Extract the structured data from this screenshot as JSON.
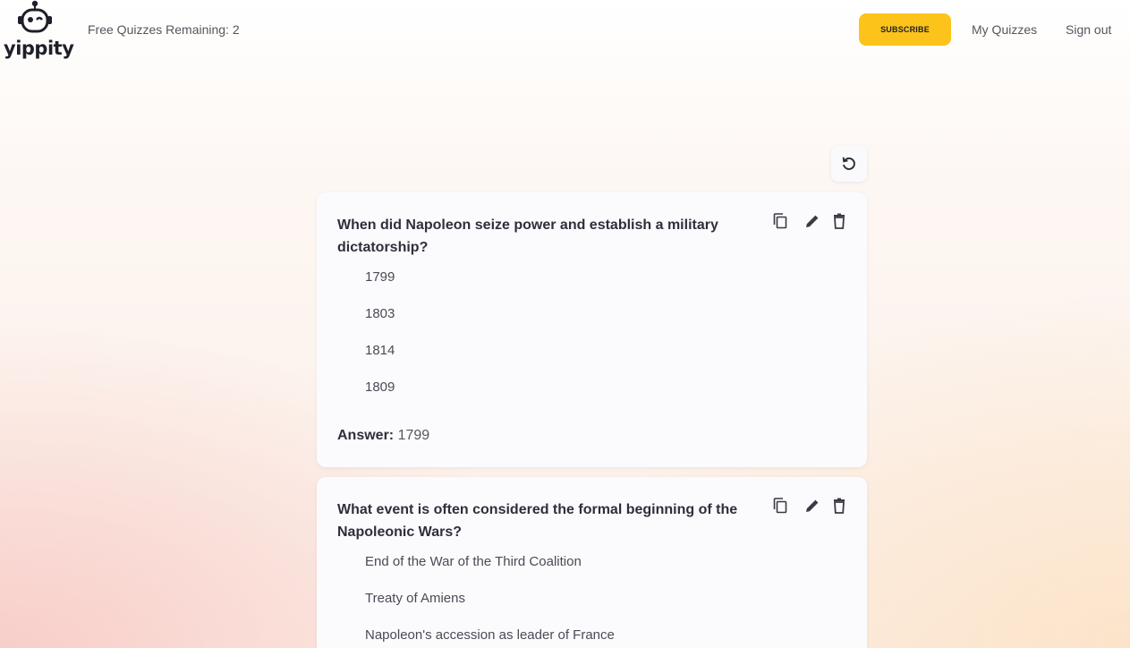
{
  "header": {
    "logo_text": "yippity",
    "free_quizzes": "Free Quizzes Remaining: 2",
    "subscribe_label": "SUBSCRIBE",
    "my_quizzes_label": "My Quizzes",
    "sign_out_label": "Sign out"
  },
  "colors": {
    "accent": "#fcc41a",
    "text": "#2f2f3b",
    "card_bg": "#fbfbfe"
  },
  "icons": {
    "reset": "refresh-icon",
    "copy": "copy-icon",
    "edit": "pencil-icon",
    "delete": "trash-icon"
  },
  "questions": [
    {
      "question": "When did Napoleon seize power and establish a military dictatorship?",
      "options": [
        "1799",
        "1803",
        "1814",
        "1809"
      ],
      "answer_label": "Answer:",
      "answer_value": "1799"
    },
    {
      "question": "What event is often considered the formal beginning of the Napoleonic Wars?",
      "options": [
        "End of the War of the Third Coalition",
        "Treaty of Amiens",
        "Napoleon's accession as leader of France"
      ]
    }
  ]
}
